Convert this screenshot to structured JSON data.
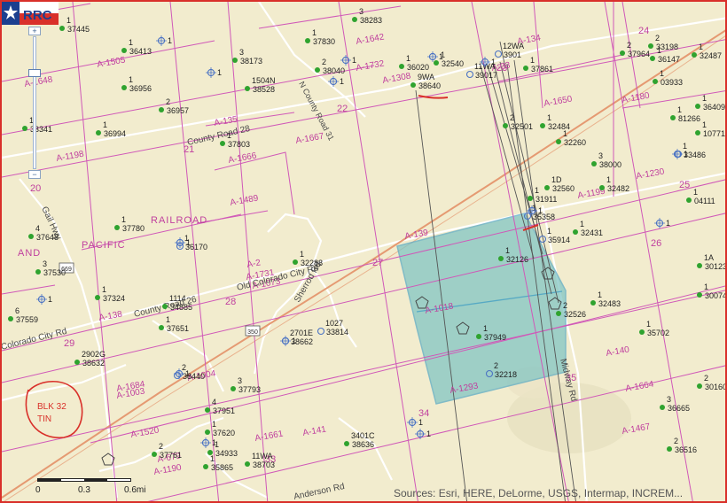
{
  "map": {
    "zoom_in_label": "+",
    "zoom_out_label": "−",
    "scale_labels": [
      "0",
      "0.3",
      "0.6mi"
    ],
    "attribution": "Sources: Esri, HERE, DeLorme, USGS, Intermap, INCREM...",
    "colors": {
      "background": "#f2ecce",
      "survey_lines": "#d058b8",
      "abstract_text": "#c0409e",
      "section_text": "#c0409e",
      "roads": "#ffffff",
      "railroad": "#e59a72",
      "highlight_fill": "#7fc4c4",
      "highlight_edge": "#56a9c4",
      "well_green": "#2fa32f",
      "well_blue": "#4b73c4",
      "annotation_red": "#d9302a",
      "pipeline": "#555555"
    },
    "logo_text": "RRC",
    "handwritten_note": "BLK 32 TIN"
  },
  "abstracts": [
    "A-132",
    "A-1505",
    "A-1648",
    "A-1198",
    "A-135",
    "A-1666",
    "A-1667",
    "A-1489",
    "A-1642",
    "A-1732",
    "A-1308",
    "A-134",
    "A-1650",
    "A-1180",
    "A-1230",
    "A-1199",
    "A-139",
    "A-2",
    "A-1731",
    "A-1073",
    "A-138",
    "A-1018",
    "A-1684",
    "A-1003",
    "A-1004",
    "A-1520",
    "A-679",
    "A-1190",
    "A-1661",
    "A-141",
    "A-1293",
    "A-140",
    "A-1664",
    "A-1467",
    "A-23"
  ],
  "sections": [
    "21",
    "22",
    "20",
    "25",
    "27",
    "28",
    "29",
    "33",
    "34",
    "35",
    "24",
    "26",
    "23"
  ],
  "road_labels": [
    "County Road 28",
    "N County Road 31",
    "Old Colorado City Rd",
    "Gail Hwy",
    "Sherrod Rd",
    "County Road 26",
    "Colorado City Rd",
    "Midway Rd",
    "Anderson Rd"
  ],
  "place_labels": [
    "PACIFIC",
    "RAILROAD",
    "AND"
  ],
  "route_shields": [
    "669",
    "350"
  ],
  "wells": [
    {
      "id": "37445",
      "num": "1",
      "c": "g"
    },
    {
      "id": "36413",
      "num": "1",
      "c": "g"
    },
    {
      "id": "36956",
      "num": "1",
      "c": "g"
    },
    {
      "id": "36957",
      "num": "2",
      "c": "g"
    },
    {
      "id": "36994",
      "num": "1",
      "c": "g"
    },
    {
      "id": "38283",
      "num": "3",
      "c": "g"
    },
    {
      "id": "37830",
      "num": "1",
      "c": "g"
    },
    {
      "id": "38173",
      "num": "3",
      "c": "g"
    },
    {
      "id": "38040",
      "num": "2",
      "c": "g"
    },
    {
      "id": "38528",
      "num": "1504N",
      "c": "g"
    },
    {
      "id": "36020",
      "num": "1",
      "c": "g"
    },
    {
      "id": "32540",
      "num": "1",
      "c": "g"
    },
    {
      "id": "38640",
      "num": "9WA",
      "c": "g"
    },
    {
      "id": "37861",
      "num": "1",
      "c": "g"
    },
    {
      "id": "37803",
      "num": "1",
      "c": "g"
    },
    {
      "id": "32501",
      "num": "2",
      "c": "g"
    },
    {
      "id": "32484",
      "num": "1",
      "c": "g"
    },
    {
      "id": "32260",
      "num": "1",
      "c": "g"
    },
    {
      "id": "38000",
      "num": "3",
      "c": "g"
    },
    {
      "id": "32560",
      "num": "1D",
      "c": "g"
    },
    {
      "id": "32482",
      "num": "1",
      "c": "g"
    },
    {
      "id": "37964",
      "num": "2",
      "c": "g"
    },
    {
      "id": "33198",
      "num": "2",
      "c": "g"
    },
    {
      "id": "36147",
      "num": "1",
      "c": "g"
    },
    {
      "id": "32487",
      "num": "1",
      "c": "g"
    },
    {
      "id": "03933",
      "num": "1",
      "c": "g"
    },
    {
      "id": "36409",
      "num": "1",
      "c": "g"
    },
    {
      "id": "81266",
      "num": "1",
      "c": "g"
    },
    {
      "id": "10771",
      "num": "1",
      "c": "g"
    },
    {
      "id": "33486",
      "num": "1",
      "c": "b"
    },
    {
      "id": "04111",
      "num": "1",
      "c": "g"
    },
    {
      "id": "37780",
      "num": "1",
      "c": "g"
    },
    {
      "id": "37648",
      "num": "4",
      "c": "g"
    },
    {
      "id": "36170",
      "num": "1",
      "c": "b"
    },
    {
      "id": "32288",
      "num": "1",
      "c": "g"
    },
    {
      "id": "32126",
      "num": "1",
      "c": "g"
    },
    {
      "id": "32431",
      "num": "1",
      "c": "g"
    },
    {
      "id": "35358",
      "num": "1",
      "c": "b"
    },
    {
      "id": "35914",
      "num": "1",
      "c": "b"
    },
    {
      "id": "31911",
      "num": "1",
      "c": "g"
    },
    {
      "id": "37530",
      "num": "3",
      "c": "g"
    },
    {
      "id": "37324",
      "num": "1",
      "c": "g"
    },
    {
      "id": "34885",
      "num": "1114",
      "c": "g"
    },
    {
      "id": "37559",
      "num": "6",
      "c": "g"
    },
    {
      "id": "37651",
      "num": "1",
      "c": "g"
    },
    {
      "id": "38662",
      "num": "2701E",
      "c": "b"
    },
    {
      "id": "33814",
      "num": "1027",
      "c": "b"
    },
    {
      "id": "37949",
      "num": "1",
      "c": "g"
    },
    {
      "id": "32526",
      "num": "2",
      "c": "g"
    },
    {
      "id": "32483",
      "num": "1",
      "c": "g"
    },
    {
      "id": "35702",
      "num": "1",
      "c": "g"
    },
    {
      "id": "30123",
      "num": "1A",
      "c": "g"
    },
    {
      "id": "30074",
      "num": "1",
      "c": "g"
    },
    {
      "id": "38632",
      "num": "2902G",
      "c": "g"
    },
    {
      "id": "38440",
      "num": "2",
      "c": "b"
    },
    {
      "id": "32218",
      "num": "2",
      "c": "b"
    },
    {
      "id": "37793",
      "num": "3",
      "c": "g"
    },
    {
      "id": "37951",
      "num": "4",
      "c": "g"
    },
    {
      "id": "37620",
      "num": "1",
      "c": "g"
    },
    {
      "id": "37761",
      "num": "2",
      "c": "g"
    },
    {
      "id": "34933",
      "num": "1",
      "c": "g"
    },
    {
      "id": "35865",
      "num": "1",
      "c": "g"
    },
    {
      "id": "38703",
      "num": "11WA",
      "c": "g"
    },
    {
      "id": "38636",
      "num": "3401C",
      "c": "g"
    },
    {
      "id": "36665",
      "num": "3",
      "c": "g"
    },
    {
      "id": "36516",
      "num": "2",
      "c": "g"
    },
    {
      "id": "30160",
      "num": "2",
      "c": "g"
    },
    {
      "id": "37941",
      "num": "1",
      "c": "g"
    },
    {
      "id": "33341",
      "num": "1",
      "c": "g"
    },
    {
      "id": "39017",
      "num": "11WA",
      "c": "b"
    },
    {
      "id": "3901",
      "num": "12WA",
      "c": "b"
    }
  ],
  "standalone_wells": [
    "1",
    "1",
    "1",
    "1",
    "1",
    "1",
    "1",
    "1",
    "1",
    "1",
    "1",
    "1",
    "1",
    "1",
    "1",
    "1"
  ]
}
